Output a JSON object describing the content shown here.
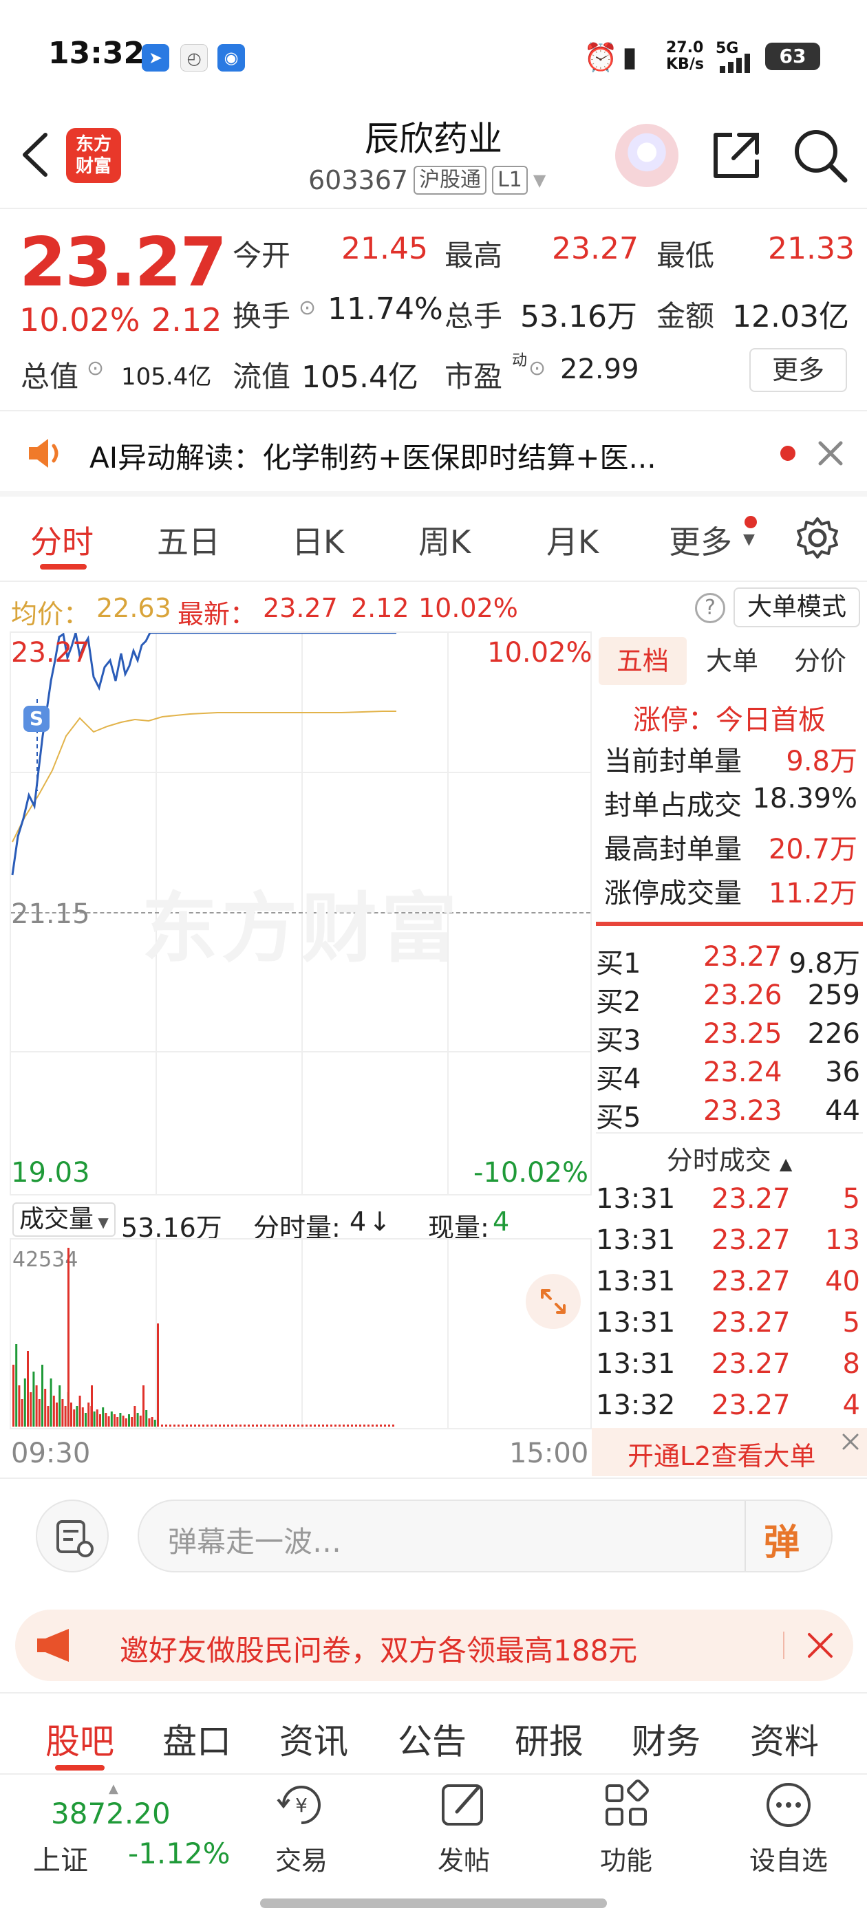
{
  "status_bar": {
    "time": "13:32",
    "net_speed_top": "27.0",
    "net_speed_bottom": "KB/s",
    "network": "5G",
    "battery": "63"
  },
  "header": {
    "logo_line1": "东方",
    "logo_line2": "财富",
    "title": "辰欣药业",
    "code": "603367",
    "tag1": "沪股通",
    "tag2": "L1"
  },
  "quote": {
    "price": "23.27",
    "pct": "10.02%",
    "change": "2.12",
    "open_label": "今开",
    "open": "21.45",
    "high_label": "最高",
    "high": "23.27",
    "low_label": "最低",
    "low": "21.33",
    "turnover_label": "换手",
    "turnover": "11.74%",
    "volume_label": "总手",
    "volume": "53.16万",
    "amount_label": "金额",
    "amount": "12.03亿",
    "mcap_label": "总值",
    "mcap": "105.4亿",
    "float_label": "流值",
    "float": "105.4亿",
    "pe_label": "市盈",
    "pe_sup": "动",
    "pe": "22.99",
    "more": "更多"
  },
  "ai_banner": {
    "text": "AI异动解读：化学制药+医保即时结算+医..."
  },
  "chart_tabs": [
    "分时",
    "五日",
    "日K",
    "周K",
    "月K",
    "更多"
  ],
  "info_bar": {
    "avg_label": "均价：",
    "avg": "22.63",
    "latest_label": "最新：",
    "latest": "23.27",
    "change": "2.12",
    "pct": "10.02%",
    "mode": "大单模式"
  },
  "intraday": {
    "top_price": "23.27",
    "top_pct": "10.02%",
    "mid_price": "21.15",
    "bottom_price": "19.03",
    "bottom_pct": "-10.02%",
    "watermark": "东方财富",
    "marker": "S"
  },
  "volume": {
    "label": "成交量",
    "total": "53.16万",
    "minute_label": "分时量:",
    "minute_value": "4",
    "minute_arrow": "↓",
    "now_label": "现量:",
    "now_value": "4",
    "max": "42534",
    "start_time": "09:30",
    "end_time": "15:00"
  },
  "order_book": {
    "tabs": [
      "五档",
      "大单",
      "分价"
    ],
    "limit_title": "涨停：今日首板",
    "stats": [
      {
        "label": "当前封单量",
        "value": "9.8万"
      },
      {
        "label": "封单占成交",
        "value": "18.39%"
      },
      {
        "label": "最高封单量",
        "value": "20.7万"
      },
      {
        "label": "涨停成交量",
        "value": "11.2万"
      }
    ],
    "bids": [
      {
        "label": "买1",
        "price": "23.27",
        "vol": "9.8万"
      },
      {
        "label": "买2",
        "price": "23.26",
        "vol": "259"
      },
      {
        "label": "买3",
        "price": "23.25",
        "vol": "226"
      },
      {
        "label": "买4",
        "price": "23.24",
        "vol": "36"
      },
      {
        "label": "买5",
        "price": "23.23",
        "vol": "44"
      }
    ],
    "ticks_title": "分时成交",
    "ticks": [
      {
        "time": "13:31",
        "price": "23.27",
        "vol": "5"
      },
      {
        "time": "13:31",
        "price": "23.27",
        "vol": "13"
      },
      {
        "time": "13:31",
        "price": "23.27",
        "vol": "40"
      },
      {
        "time": "13:31",
        "price": "23.27",
        "vol": "5"
      },
      {
        "time": "13:31",
        "price": "23.27",
        "vol": "8"
      },
      {
        "time": "13:32",
        "price": "23.27",
        "vol": "4"
      }
    ],
    "l2_banner": "开通L2查看大单"
  },
  "comment": {
    "placeholder": "弹幕走一波…",
    "danmu_label": "弹"
  },
  "invite": {
    "text": "邀好友做股民问卷，双方各领最高188元"
  },
  "bottom_tabs": [
    "股吧",
    "盘口",
    "资讯",
    "公告",
    "研报",
    "财务",
    "资料"
  ],
  "bottom_nav": {
    "index_value": "3872.20",
    "index_name": "上证",
    "index_change": "-1.12%",
    "items": [
      "交易",
      "发帖",
      "功能",
      "设自选"
    ]
  },
  "colors": {
    "up": "#e0312a",
    "down": "#1f9a38",
    "price_line": "#2a5cb8",
    "avg_line": "#e2b34a"
  }
}
